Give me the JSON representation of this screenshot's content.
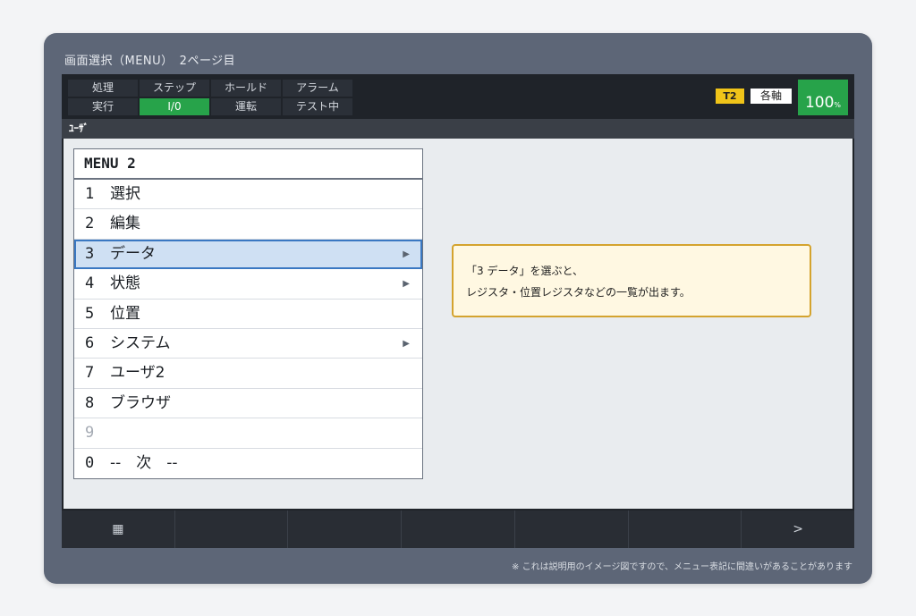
{
  "window": {
    "title": "画面選択（MENU）　2ページ目"
  },
  "status": {
    "rows": [
      [
        "処理",
        "ステップ",
        "ホールド",
        "アラーム"
      ],
      [
        "実行",
        "I/0",
        "運転",
        "テスト中"
      ]
    ],
    "active_cell": "I/0",
    "tool": "T2",
    "axis": "各軸",
    "speed": "100",
    "speed_unit": "%"
  },
  "user_bar": {
    "label": "ﾕｰｻﾞ"
  },
  "menu": {
    "header": "MENU 2",
    "items": [
      {
        "no": "1",
        "label": "選択",
        "arrow": ""
      },
      {
        "no": "2",
        "label": "編集",
        "arrow": ""
      },
      {
        "no": "3",
        "label": "データ",
        "arrow": "▶"
      },
      {
        "no": "4",
        "label": "状態",
        "arrow": "▶"
      },
      {
        "no": "5",
        "label": "位置",
        "arrow": ""
      },
      {
        "no": "6",
        "label": "システム",
        "arrow": "▶"
      },
      {
        "no": "7",
        "label": "ユーザ2",
        "arrow": ""
      },
      {
        "no": "8",
        "label": "ブラウザ",
        "arrow": ""
      },
      {
        "no": "9",
        "label": "",
        "arrow": ""
      },
      {
        "no": "0",
        "label": "--　次　--",
        "arrow": ""
      }
    ],
    "selected_index": 2
  },
  "callout": {
    "line1": "「3 データ」を選ぶと、",
    "line2": "レジスタ・位置レジスタなどの一覧が出ます。"
  },
  "function_keys": [
    {
      "label": "▦",
      "icon": "grid-icon"
    },
    {
      "label": ""
    },
    {
      "label": ""
    },
    {
      "label": ""
    },
    {
      "label": ""
    },
    {
      "label": ""
    },
    {
      "label": ">",
      "icon": "next-icon"
    }
  ],
  "footer_note": "※ これは説明用のイメージ図ですので、メニュー表記に間違いがあることがあります",
  "colors": {
    "frame": "#5d6677",
    "active_green": "#27a34a",
    "tool_yellow": "#f0c419",
    "selected_blue": "#cfe0f3",
    "callout_border": "#d4a32e"
  }
}
